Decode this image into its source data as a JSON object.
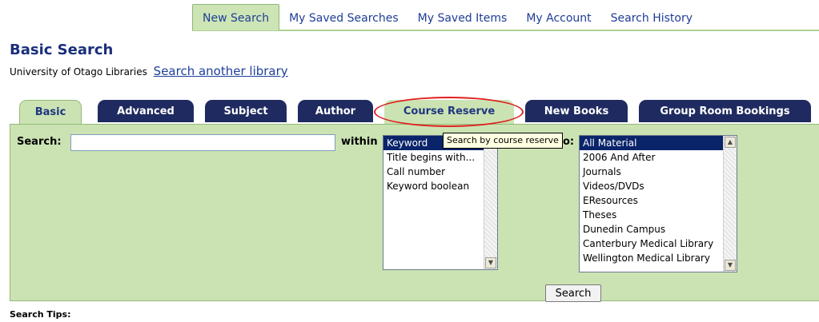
{
  "top_nav": {
    "tabs": [
      {
        "label": "New Search",
        "active": true
      },
      {
        "label": "My Saved Searches",
        "active": false
      },
      {
        "label": "My Saved Items",
        "active": false
      },
      {
        "label": "My Account",
        "active": false
      },
      {
        "label": "Search History",
        "active": false
      }
    ]
  },
  "page": {
    "title": "Basic Search",
    "library_name": "University of Otago Libraries",
    "other_library_link": "Search another library"
  },
  "search_tabs": [
    {
      "label": "Basic",
      "active": true
    },
    {
      "label": "Advanced",
      "active": false
    },
    {
      "label": "Subject",
      "active": false
    },
    {
      "label": "Author",
      "active": false
    },
    {
      "label": "Course Reserve",
      "active": false,
      "highlighted": true
    },
    {
      "label": "New Books",
      "active": false
    },
    {
      "label": "Group Room Bookings",
      "active": false
    }
  ],
  "form": {
    "search_label": "Search:",
    "search_value": "",
    "within_label": "within",
    "within_options": [
      "Keyword",
      "Title begins with...",
      "Call number",
      "Keyword boolean"
    ],
    "within_selected": "Keyword",
    "limit_label_visible": "o:",
    "limit_options": [
      "All Material",
      "2006 And After",
      "Journals",
      "Videos/DVDs",
      "EResources",
      "Theses",
      "Dunedin Campus",
      "Canterbury Medical Library",
      "Wellington Medical Library"
    ],
    "limit_selected": "All Material",
    "search_button": "Search"
  },
  "tooltip": "Search by course reserve",
  "footer": {
    "tips_label": "Search Tips:"
  },
  "colors": {
    "link_blue": "#1f3d96",
    "tab_dark": "#1f2b60",
    "panel_green": "#cbe3b3",
    "highlight_red": "#e02020"
  }
}
